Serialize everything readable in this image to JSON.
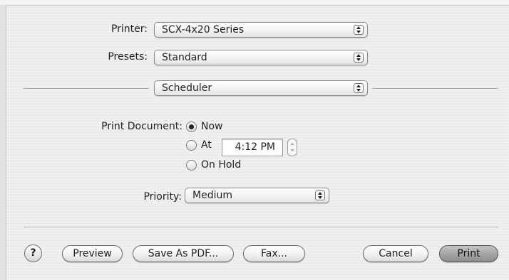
{
  "printer": {
    "label": "Printer:",
    "value": "SCX-4x20 Series"
  },
  "presets": {
    "label": "Presets:",
    "value": "Standard"
  },
  "panel": {
    "value": "Scheduler"
  },
  "print_document": {
    "label": "Print Document:",
    "options": [
      {
        "label": "Now",
        "selected": true
      },
      {
        "label": "At",
        "selected": false
      },
      {
        "label": "On Hold",
        "selected": false
      }
    ],
    "time": "4:12 PM"
  },
  "priority": {
    "label": "Priority:",
    "value": "Medium"
  },
  "buttons": {
    "help": "?",
    "preview": "Preview",
    "save_pdf": "Save As PDF...",
    "fax": "Fax...",
    "cancel": "Cancel",
    "print": "Print"
  }
}
